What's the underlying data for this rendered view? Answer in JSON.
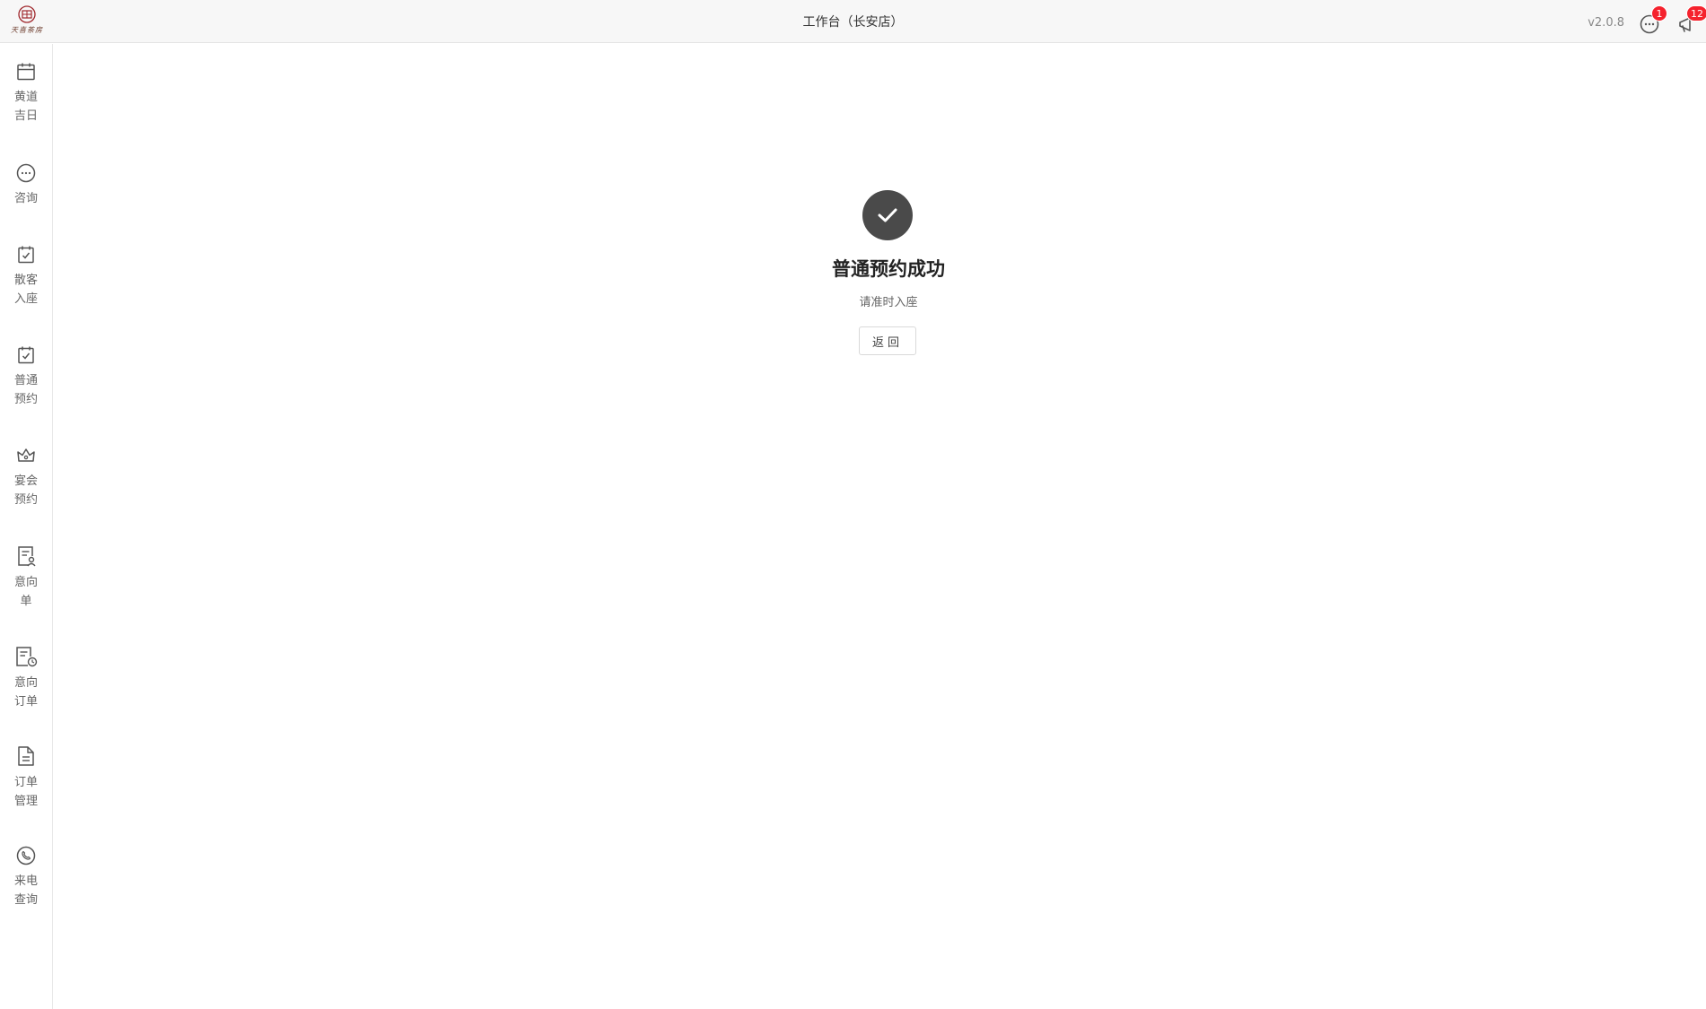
{
  "header": {
    "logo_text": "天喜茶房",
    "title": "工作台（长安店）",
    "version": "v2.0.8",
    "message_badge": "1",
    "notice_badge": "12"
  },
  "sidebar": {
    "items": [
      {
        "label": "黄道吉日",
        "icon": "calendar-icon"
      },
      {
        "label": "咨询",
        "icon": "chat-icon"
      },
      {
        "label": "散客入座",
        "icon": "calendar-check-icon"
      },
      {
        "label": "普通预约",
        "icon": "calendar-check-icon"
      },
      {
        "label": "宴会预约",
        "icon": "crown-icon"
      },
      {
        "label": "意向单",
        "icon": "user-document-icon"
      },
      {
        "label": "意向订单",
        "icon": "document-clock-icon"
      },
      {
        "label": "订单管理",
        "icon": "file-icon"
      },
      {
        "label": "来电查询",
        "icon": "phone-icon"
      }
    ]
  },
  "result": {
    "title": "普通预约成功",
    "subtitle": "请准时入座",
    "back_label": "返回"
  },
  "colors": {
    "success_icon_bg": "#4a4a4a",
    "badge": "#f5222d",
    "header_bg": "#f7f7f7",
    "logo": "#a0282d"
  }
}
